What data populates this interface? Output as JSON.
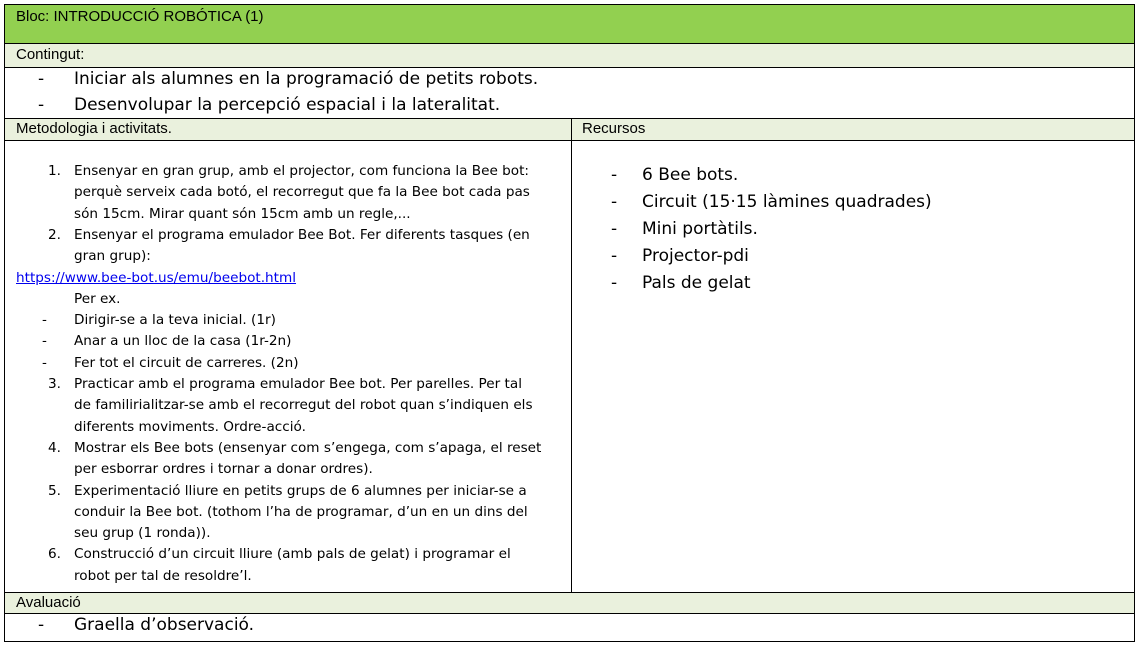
{
  "block_title": "Bloc: INTRODUCCIÓ ROBÓTICA (1)",
  "content": {
    "label": "Contingut:",
    "items": [
      "Iniciar als alumnes en la programació de petits robots.",
      "Desenvolupar la percepció espacial i la lateralitat."
    ]
  },
  "methodology": {
    "label": "Metodologia i activitats.",
    "lines": [
      {
        "num": "1.",
        "text": "Ensenyar en gran grup, amb el projector, com funciona la Bee bot:"
      },
      {
        "text": "perquè serveix cada botó, el recorregut que fa la Bee bot cada pas"
      },
      {
        "text": "són 15cm. Mirar quant són 15cm amb un regle,..."
      },
      {
        "num": "2.",
        "text": "Ensenyar el programa emulador Bee Bot. Fer diferents tasques (en"
      },
      {
        "text": "gran grup):"
      },
      {
        "link": "https://www.bee-bot.us/emu/beebot.html"
      },
      {
        "text": "Per ex."
      },
      {
        "dash": "-",
        "text": "Dirigir-se a la teva inicial. (1r)"
      },
      {
        "dash": "-",
        "text": "Anar a un lloc de la casa (1r-2n)"
      },
      {
        "dash": "-",
        "text": "Fer tot el circuit de carreres. (2n)"
      },
      {
        "num": "3.",
        "text": "Practicar amb el programa emulador Bee bot. Per parelles. Per tal"
      },
      {
        "text": "de familirialitzar-se amb el recorregut del robot quan s’indiquen els"
      },
      {
        "text": "diferents moviments. Ordre-acció."
      },
      {
        "num": "4.",
        "text": "Mostrar els Bee bots (ensenyar com s’engega, com s’apaga, el reset"
      },
      {
        "text": "per esborrar ordres i tornar a donar ordres)."
      },
      {
        "num": "5.",
        "text": "Experimentació lliure en petits grups de 6 alumnes per iniciar-se a"
      },
      {
        "text": "conduir la Bee bot. (tothom l’ha de programar, d’un en un dins del"
      },
      {
        "text": "seu grup (1 ronda))."
      },
      {
        "num": "6.",
        "text": "Construcció d’un circuit lliure (amb pals de gelat) i programar el"
      },
      {
        "text": "robot per tal de resoldre’l."
      }
    ]
  },
  "resources": {
    "label": "Recursos",
    "items": [
      "6 Bee bots.",
      "Circuit (15·15 làmines quadrades)",
      "Mini portàtils.",
      "Projector-pdi",
      "Pals de gelat"
    ]
  },
  "evaluation": {
    "label": "Avaluació",
    "items": [
      "Graella d’observació."
    ]
  },
  "dash": "-",
  "colors": {
    "title_bg": "#92d050",
    "label_bg": "#eaf1dd",
    "link": "#0000ee"
  }
}
